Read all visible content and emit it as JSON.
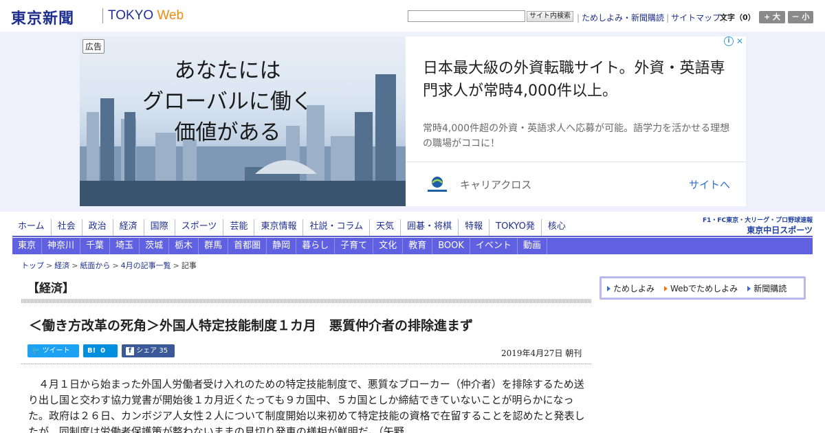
{
  "header": {
    "logo": "東京新聞",
    "logo_sub": "TOKYO",
    "logo_sub_web": "Web",
    "search_button": "サイト内検索",
    "links": [
      "ためしよみ・新聞購読",
      "サイトマップ"
    ],
    "font_size_label": "文字（0）",
    "font_large": "+ 大",
    "font_small": "－ 小"
  },
  "ad": {
    "label": "広告",
    "headline": [
      "あなたには",
      "グローバルに働く",
      "価値がある"
    ],
    "title": "日本最大級の外資転職サイト。外資・英語専門求人が常時4,000件以上。",
    "description": "常時4,000件超の外資・英語求人へ応募が可能。語学力を活かせる理想の職場がココに！",
    "advertiser": "キャリアクロス",
    "cta": "サイトへ"
  },
  "nav_main": [
    "ホーム",
    "社会",
    "政治",
    "経済",
    "国際",
    "スポーツ",
    "芸能",
    "東京情報",
    "社説・コラム",
    "天気",
    "囲碁・将棋",
    "特報",
    "TOKYO発",
    "核心"
  ],
  "nav_sub": [
    "東京",
    "神奈川",
    "千葉",
    "埼玉",
    "茨城",
    "栃木",
    "群馬",
    "首都圏",
    "静岡",
    "暮らし",
    "子育て",
    "文化",
    "教育",
    "BOOK",
    "イベント",
    "動画"
  ],
  "chunichi": {
    "line1": "F1・FC東京・大リーグ・プロ野球速報",
    "line2": "東京中日スポーツ"
  },
  "breadcrumb": [
    "トップ",
    "経済",
    "紙面から",
    "4月の記事一覧",
    "記事"
  ],
  "article": {
    "section": "【経済】",
    "headline": "＜働き方改革の死角＞外国人特定技能制度１カ月　悪質仲介者の排除進まず",
    "tweet": "ツイート",
    "hatena": "B!",
    "hatena_count": "0",
    "share": "シェア",
    "share_count": "35",
    "date": "2019年4月27日 朝刊",
    "body": "　４月１日から始まった外国人労働者受け入れのための特定技能制度で、悪質なブローカー（仲介者）を排除するため送り出し国と交わす協力覚書が開始後１カ月近くたっても９カ国中、５カ国としか締結できていないことが明らかになった。政府は２６日、カンボジア人女性２人について制度開始以来初めて特定技能の資格で在留することを認めたと発表したが、同制度は労働者保護策が整わないままの見切り発車の様相が鮮明だ。（矢野"
  },
  "sidebar": {
    "links": [
      "ためしよみ",
      "Webでためしよみ",
      "新聞購読"
    ]
  }
}
